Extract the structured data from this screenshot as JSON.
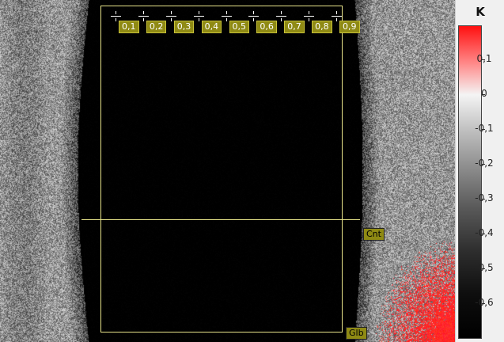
{
  "colorbar": {
    "title": "K",
    "ticks": [
      {
        "label": "0,1",
        "value": 0.1
      },
      {
        "label": "0",
        "value": 0
      },
      {
        "label": "-0,1",
        "value": -0.1
      },
      {
        "label": "-0,2",
        "value": -0.2
      },
      {
        "label": "-0,3",
        "value": -0.3
      },
      {
        "label": "-0,4",
        "value": -0.4
      },
      {
        "label": "-0,5",
        "value": -0.5
      },
      {
        "label": "-0,6",
        "value": -0.6
      }
    ],
    "colors": {
      "high": "#ff1010",
      "mid": "#f4f4f4",
      "low": "#000000"
    }
  },
  "roi": {
    "point_labels": [
      "0,1",
      "0,2",
      "0,3",
      "0,4",
      "0,5",
      "0,6",
      "0,7",
      "0,8",
      "0,9"
    ],
    "center_label": "Cnt",
    "global_label": "Glb",
    "outline_color": "#e8e48a",
    "tag_color": "#8f8a14"
  }
}
